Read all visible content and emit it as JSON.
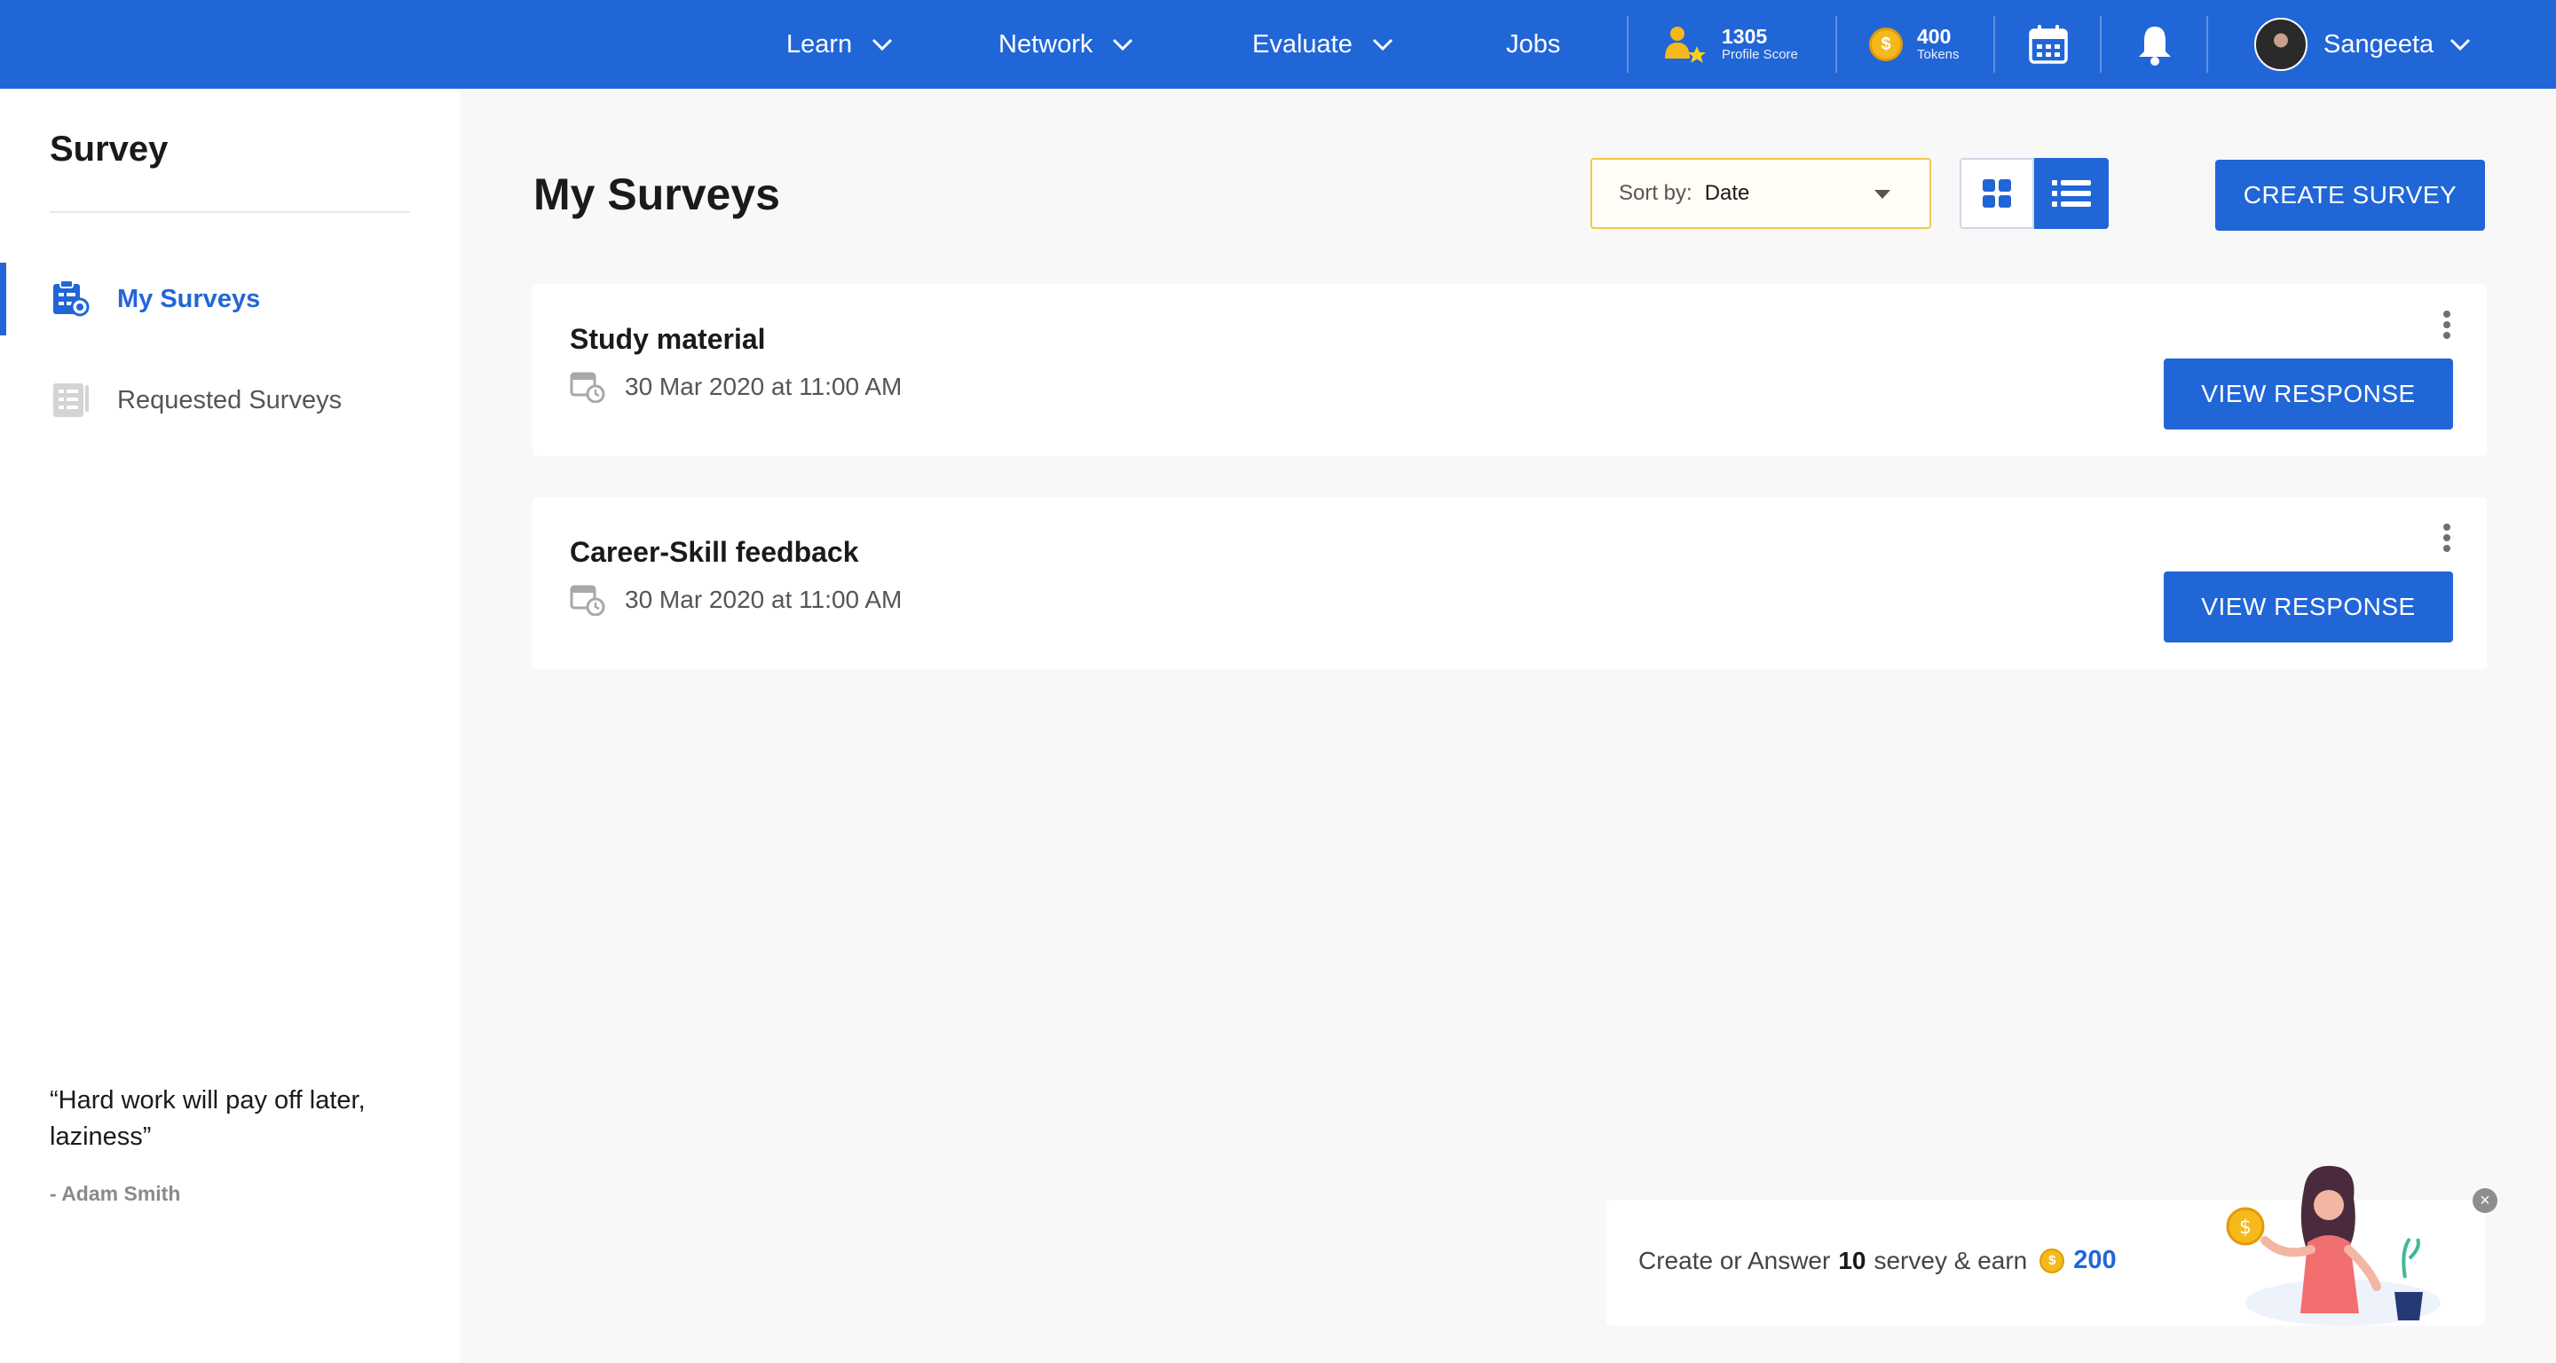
{
  "topbar": {
    "nav": [
      {
        "label": "Learn",
        "has_dropdown": true
      },
      {
        "label": "Network",
        "has_dropdown": true
      },
      {
        "label": "Evaluate",
        "has_dropdown": true
      },
      {
        "label": "Jobs",
        "has_dropdown": false
      }
    ],
    "profile_score": {
      "value": "1305",
      "label": "Profile Score"
    },
    "tokens": {
      "value": "400",
      "label": "Tokens",
      "coin_symbol": "$"
    },
    "icons": [
      "profile-score-icon",
      "coin-icon",
      "calendar-icon",
      "bell-icon"
    ],
    "user": {
      "name": "Sangeeta"
    }
  },
  "sidebar": {
    "title": "Survey",
    "items": [
      {
        "label": "My Surveys",
        "active": true,
        "icon": "my-surveys-icon"
      },
      {
        "label": "Requested Surveys",
        "active": false,
        "icon": "requested-surveys-icon"
      }
    ],
    "quote": {
      "text": "“Hard work will pay off later, laziness”",
      "author": "- Adam Smith"
    }
  },
  "main": {
    "title": "My Surveys",
    "sort": {
      "label": "Sort by:",
      "value": "Date"
    },
    "view_modes": [
      "grid",
      "list"
    ],
    "active_view": "list",
    "create_button": "CREATE SURVEY",
    "surveys": [
      {
        "title": "Study material",
        "date": "30 Mar 2020 at 11:00 AM",
        "action": "VIEW RESPONSE"
      },
      {
        "title": "Career-Skill feedback",
        "date": "30 Mar 2020 at 11:00 AM",
        "action": "VIEW RESPONSE"
      }
    ]
  },
  "promo": {
    "prefix": "Create or Answer",
    "count": "10",
    "suffix": "servey & earn",
    "coin_symbol": "$",
    "amount": "200",
    "close_label": "×"
  },
  "colors": {
    "primary": "#2166d7",
    "coin": "#f5b91c",
    "sort_border": "#f2c74a",
    "background": "#f8f8f8"
  }
}
